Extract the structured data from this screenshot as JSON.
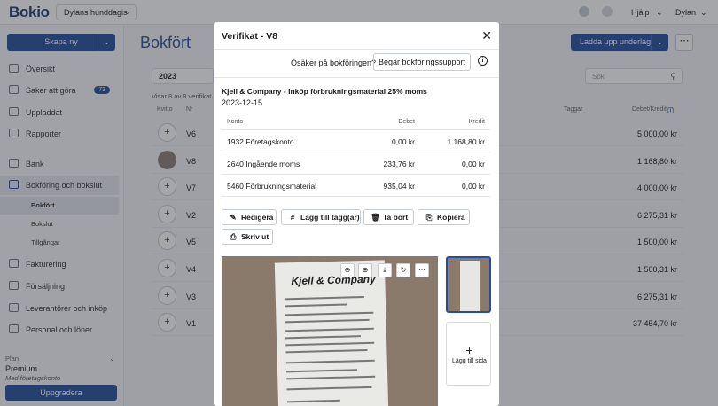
{
  "app": {
    "logo": "Bokio",
    "company": "Dylans hunddagis"
  },
  "topbar": {
    "help": "Hjälp",
    "user": "Dylan"
  },
  "sidebar": {
    "create_button": "Skapa ny",
    "items": [
      {
        "label": "Översikt"
      },
      {
        "label": "Saker att göra",
        "badge": "73"
      },
      {
        "label": "Uppladdat"
      },
      {
        "label": "Rapporter"
      },
      {
        "label": "Bank"
      },
      {
        "label": "Bokföring och bokslut"
      },
      {
        "label": "Fakturering"
      },
      {
        "label": "Försäljning"
      },
      {
        "label": "Leverantörer och inköp"
      },
      {
        "label": "Personal och löner"
      }
    ],
    "subitems": [
      {
        "label": "Bokfört"
      },
      {
        "label": "Bokslut"
      },
      {
        "label": "Tillgångar"
      }
    ],
    "plan": {
      "label": "Plan",
      "name": "Premium",
      "sub": "Med företagskonto",
      "upgrade": "Uppgradera"
    }
  },
  "main": {
    "title": "Bokfört",
    "upload_button": "Ladda upp underlag",
    "year": "2023",
    "search_placeholder": "Sök",
    "count_text": "Visar 8 av 8 verifikat",
    "columns": {
      "kvitto": "Kvitto",
      "nr": "Nr",
      "taggar": "Taggar",
      "debet_kredit": "Debet/Kredit"
    },
    "rows": [
      {
        "nr": "V6",
        "amount": "5 000,00 kr",
        "thumb": "plus"
      },
      {
        "nr": "V8",
        "amount": "1 168,80 kr",
        "thumb": "image"
      },
      {
        "nr": "V7",
        "amount": "4 000,00 kr",
        "thumb": "plus"
      },
      {
        "nr": "V2",
        "amount": "6 275,31 kr",
        "thumb": "plus"
      },
      {
        "nr": "V5",
        "amount": "1 500,00 kr",
        "thumb": "plus"
      },
      {
        "nr": "V4",
        "amount": "1 500,31 kr",
        "thumb": "plus"
      },
      {
        "nr": "V3",
        "amount": "6 275,31 kr",
        "thumb": "plus"
      },
      {
        "nr": "V1",
        "amount": "37 454,70 kr",
        "thumb": "plus"
      }
    ]
  },
  "modal": {
    "title": "Verifikat - V8",
    "unsure_text": "Osäker på bokföringen?",
    "support_button": "Begär bokföringssupport",
    "description": "Kjell & Company - Inköp förbrukningsmaterial 25% moms",
    "date": "2023-12-15",
    "table": {
      "headers": {
        "konto": "Konto",
        "debet": "Debet",
        "kredit": "Kredit"
      },
      "rows": [
        {
          "konto": "1932 Företagskonto",
          "debet": "0,00 kr",
          "kredit": "1 168,80 kr"
        },
        {
          "konto": "2640 Ingående moms",
          "debet": "233,76 kr",
          "kredit": "0,00 kr"
        },
        {
          "konto": "5460 Förbrukningsmaterial",
          "debet": "935,04 kr",
          "kredit": "0,00 kr"
        }
      ]
    },
    "actions": {
      "edit": "Redigera",
      "tag": "Lägg till tagg(ar)",
      "delete": "Ta bort",
      "copy": "Kopiera",
      "print": "Skriv ut"
    },
    "receipt_brand": "Kjell & Company",
    "add_page": "Lägg till sida"
  },
  "colors": {
    "primary": "#24509b",
    "overlay": "rgba(40,44,52,0.42)"
  }
}
